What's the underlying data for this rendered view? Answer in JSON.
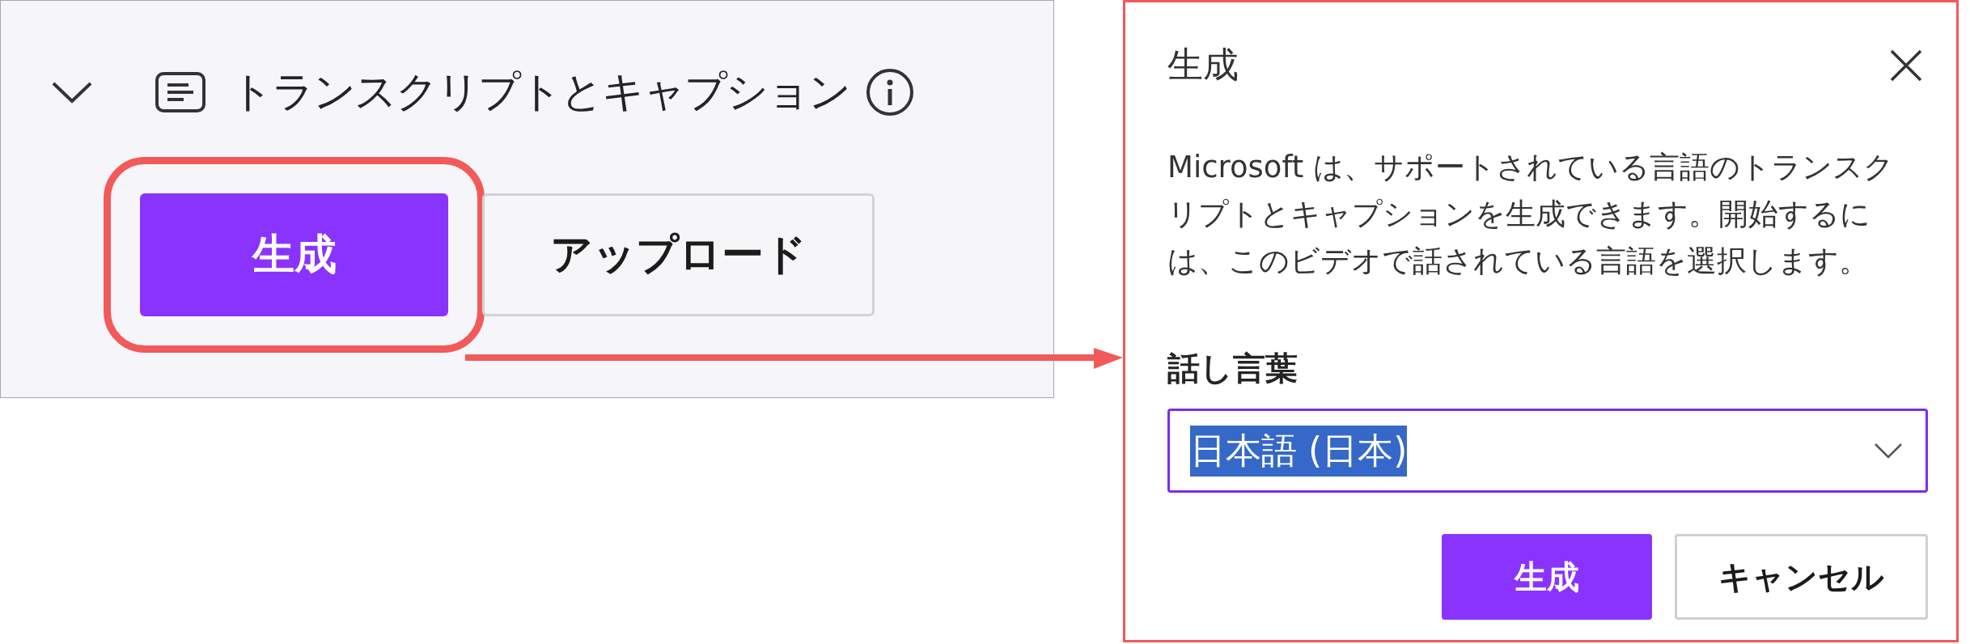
{
  "section": {
    "title": "トランスクリプトとキャプション",
    "expanded": true,
    "buttons": [
      {
        "label": "生成",
        "kind": "primary",
        "highlighted": true
      },
      {
        "label": "アップロード",
        "kind": "secondary",
        "highlighted": false
      }
    ]
  },
  "dialog": {
    "title": "生成",
    "description": "Microsoft は、サポートされている言語のトランスクリプトとキャプションを生成できます。開始するには、このビデオで話されている言語を選択します。",
    "field": {
      "label": "話し言葉",
      "value": "日本語 (日本)",
      "value_selected": true,
      "focused": true
    },
    "buttons": [
      {
        "label": "生成",
        "kind": "primary"
      },
      {
        "label": "キャンセル",
        "kind": "secondary"
      }
    ]
  }
}
